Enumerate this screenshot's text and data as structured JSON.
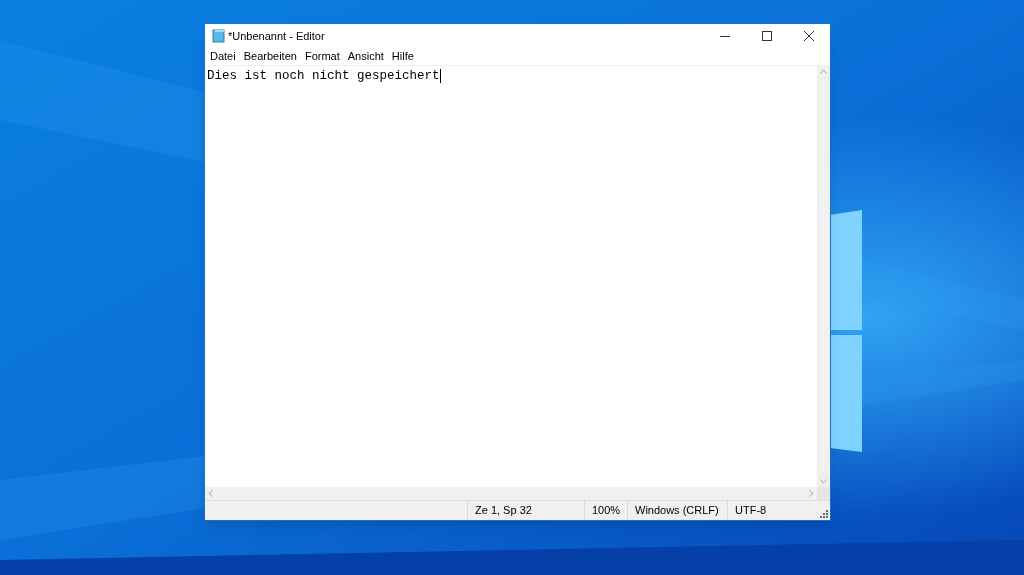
{
  "window": {
    "title": "*Unbenannt - Editor"
  },
  "menu": [
    {
      "label": "Datei"
    },
    {
      "label": "Bearbeiten"
    },
    {
      "label": "Format"
    },
    {
      "label": "Ansicht"
    },
    {
      "label": "Hilfe"
    }
  ],
  "editor": {
    "text": "Dies ist noch nicht gespeichert"
  },
  "status_bar": [
    "Ze 1, Sp 32",
    "100%",
    "Windows (CRLF)",
    "UTF-8"
  ]
}
